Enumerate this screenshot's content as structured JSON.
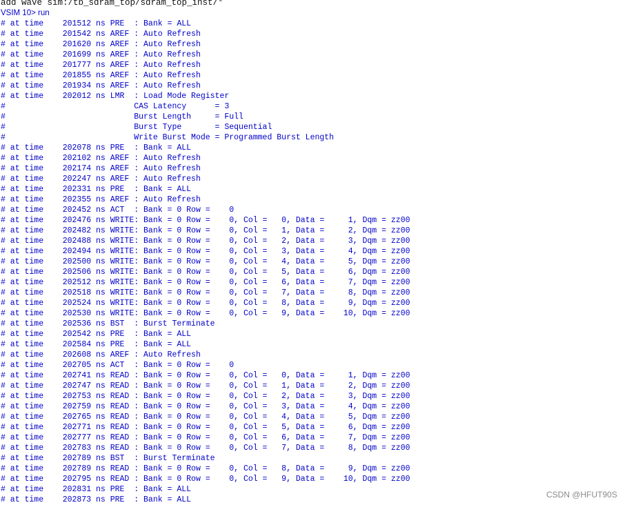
{
  "console": {
    "command": "add wave sim:/tb_sdram_top/sdram_top_inst/*",
    "prompt": "VSIM 10>",
    "prompt_command": "run",
    "lines": [
      "# at time    201512 ns PRE  : Bank = ALL",
      "# at time    201542 ns AREF : Auto Refresh",
      "# at time    201620 ns AREF : Auto Refresh",
      "# at time    201699 ns AREF : Auto Refresh",
      "# at time    201777 ns AREF : Auto Refresh",
      "# at time    201855 ns AREF : Auto Refresh",
      "# at time    201934 ns AREF : Auto Refresh",
      "# at time    202012 ns LMR  : Load Mode Register",
      "#                           CAS Latency      = 3",
      "#                           Burst Length     = Full",
      "#                           Burst Type       = Sequential",
      "#                           Write Burst Mode = Programmed Burst Length",
      "# at time    202078 ns PRE  : Bank = ALL",
      "# at time    202102 ns AREF : Auto Refresh",
      "# at time    202174 ns AREF : Auto Refresh",
      "# at time    202247 ns AREF : Auto Refresh",
      "# at time    202331 ns PRE  : Bank = ALL",
      "# at time    202355 ns AREF : Auto Refresh",
      "# at time    202452 ns ACT  : Bank = 0 Row =    0",
      "# at time    202476 ns WRITE: Bank = 0 Row =    0, Col =   0, Data =     1, Dqm = zz00",
      "# at time    202482 ns WRITE: Bank = 0 Row =    0, Col =   1, Data =     2, Dqm = zz00",
      "# at time    202488 ns WRITE: Bank = 0 Row =    0, Col =   2, Data =     3, Dqm = zz00",
      "# at time    202494 ns WRITE: Bank = 0 Row =    0, Col =   3, Data =     4, Dqm = zz00",
      "# at time    202500 ns WRITE: Bank = 0 Row =    0, Col =   4, Data =     5, Dqm = zz00",
      "# at time    202506 ns WRITE: Bank = 0 Row =    0, Col =   5, Data =     6, Dqm = zz00",
      "# at time    202512 ns WRITE: Bank = 0 Row =    0, Col =   6, Data =     7, Dqm = zz00",
      "# at time    202518 ns WRITE: Bank = 0 Row =    0, Col =   7, Data =     8, Dqm = zz00",
      "# at time    202524 ns WRITE: Bank = 0 Row =    0, Col =   8, Data =     9, Dqm = zz00",
      "# at time    202530 ns WRITE: Bank = 0 Row =    0, Col =   9, Data =    10, Dqm = zz00",
      "# at time    202536 ns BST  : Burst Terminate",
      "# at time    202542 ns PRE  : Bank = ALL",
      "# at time    202584 ns PRE  : Bank = ALL",
      "# at time    202608 ns AREF : Auto Refresh",
      "# at time    202705 ns ACT  : Bank = 0 Row =    0",
      "# at time    202741 ns READ : Bank = 0 Row =    0, Col =   0, Data =     1, Dqm = zz00",
      "# at time    202747 ns READ : Bank = 0 Row =    0, Col =   1, Data =     2, Dqm = zz00",
      "# at time    202753 ns READ : Bank = 0 Row =    0, Col =   2, Data =     3, Dqm = zz00",
      "# at time    202759 ns READ : Bank = 0 Row =    0, Col =   3, Data =     4, Dqm = zz00",
      "# at time    202765 ns READ : Bank = 0 Row =    0, Col =   4, Data =     5, Dqm = zz00",
      "# at time    202771 ns READ : Bank = 0 Row =    0, Col =   5, Data =     6, Dqm = zz00",
      "# at time    202777 ns READ : Bank = 0 Row =    0, Col =   6, Data =     7, Dqm = zz00",
      "# at time    202783 ns READ : Bank = 0 Row =    0, Col =   7, Data =     8, Dqm = zz00",
      "# at time    202789 ns BST  : Burst Terminate",
      "# at time    202789 ns READ : Bank = 0 Row =    0, Col =   8, Data =     9, Dqm = zz00",
      "# at time    202795 ns READ : Bank = 0 Row =    0, Col =   9, Data =    10, Dqm = zz00",
      "# at time    202831 ns PRE  : Bank = ALL",
      "# at time    202873 ns PRE  : Bank = ALL"
    ]
  },
  "watermark": "CSDN @HFUT90S",
  "colors": {
    "transcript_text": "#0000c8",
    "command_text": "#111111",
    "background": "#ffffff",
    "watermark": "#8a8a8a"
  }
}
